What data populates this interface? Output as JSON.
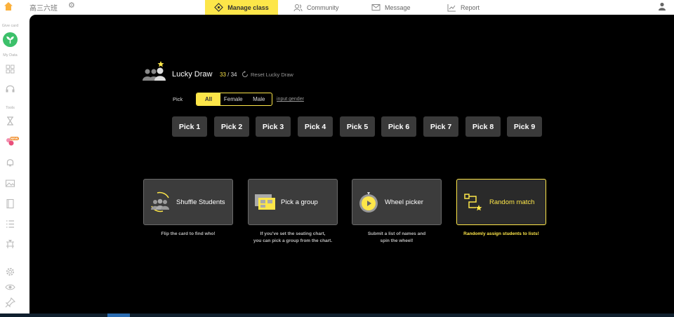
{
  "app": {
    "class_name": "高三六班"
  },
  "nav": {
    "tabs": [
      {
        "label": "Manage class",
        "icon": "class-icon",
        "active": true
      },
      {
        "label": "Community",
        "icon": "community-icon",
        "active": false
      },
      {
        "label": "Message",
        "icon": "message-icon",
        "active": false
      },
      {
        "label": "Report",
        "icon": "report-icon",
        "active": false
      }
    ]
  },
  "sidebar": {
    "give_card_label": "Give card",
    "my_data_label": "My Data",
    "tools_label": "Tools",
    "new_badge": "NEW"
  },
  "lucky_draw": {
    "title": "Lucky Draw",
    "count_current": "33",
    "count_separator": " / ",
    "count_total": "34",
    "reset_label": "Reset Lucky Draw",
    "pick_label": "Pick",
    "gender_options": [
      "All",
      "Female",
      "Male"
    ],
    "selected_gender": "All",
    "input_gender_label": "input gender",
    "pick_buttons": [
      "Pick 1",
      "Pick 2",
      "Pick 3",
      "Pick 4",
      "Pick 5",
      "Pick 6",
      "Pick 7",
      "Pick 8",
      "Pick 9"
    ]
  },
  "tools": {
    "cards": [
      {
        "title": "Shuffle Students",
        "desc_line1": "Flip the card to find who!",
        "desc_line2": "",
        "icon": "shuffle-students-icon",
        "highlight": false
      },
      {
        "title": "Pick a group",
        "desc_line1": "If you've set the seating chart,",
        "desc_line2": "you can pick a group from the chart.",
        "icon": "pick-group-icon",
        "highlight": false
      },
      {
        "title": "Wheel picker",
        "desc_line1": "Submit a list of names and",
        "desc_line2": "spin the wheel!",
        "icon": "wheel-picker-icon",
        "highlight": false
      },
      {
        "title": "Random match",
        "desc_line1": "Randomly assign students to lists!",
        "desc_line2": "",
        "icon": "random-match-icon",
        "highlight": true
      }
    ]
  },
  "colors": {
    "accent": "#fde649",
    "panel": "#000000",
    "button": "#3a3a3a",
    "card": "#3c3c3c"
  }
}
